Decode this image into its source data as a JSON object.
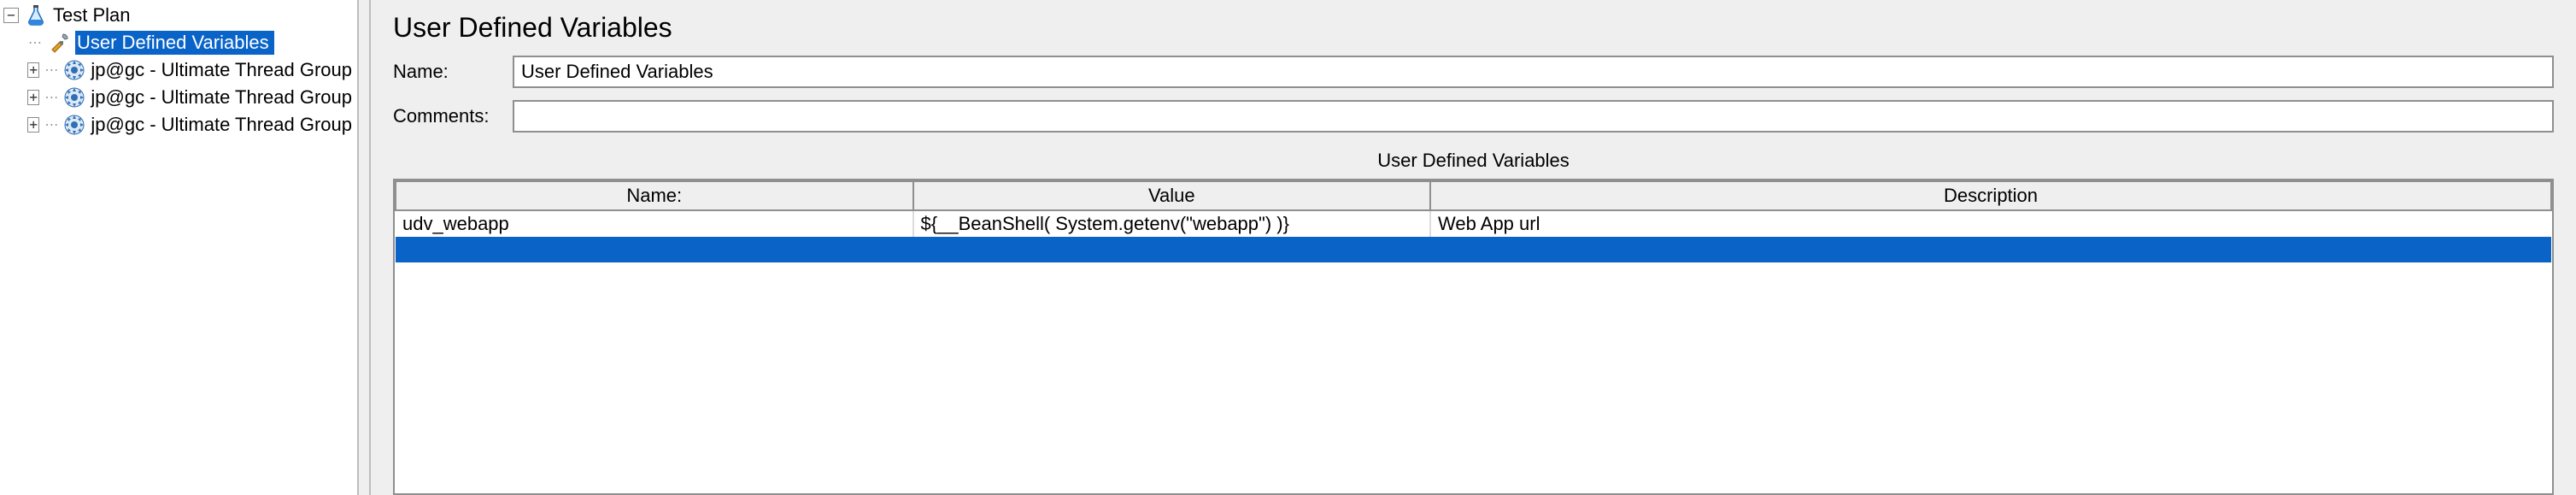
{
  "tree": {
    "root": {
      "label": "Test Plan"
    },
    "children": [
      {
        "label": "User Defined Variables",
        "selected": true,
        "iconType": "tools"
      },
      {
        "label": "jp@gc - Ultimate Thread Group",
        "selected": false,
        "expandable": true,
        "iconType": "gear"
      },
      {
        "label": "jp@gc - Ultimate Thread Group",
        "selected": false,
        "expandable": true,
        "iconType": "gear"
      },
      {
        "label": "jp@gc - Ultimate Thread Group",
        "selected": false,
        "expandable": true,
        "iconType": "gear"
      }
    ]
  },
  "main": {
    "title": "User Defined Variables",
    "form": {
      "name_label": "Name:",
      "name_value": "User Defined Variables",
      "comments_label": "Comments:",
      "comments_value": ""
    },
    "section_label": "User Defined Variables",
    "table": {
      "headers": {
        "name": "Name:",
        "value": "Value",
        "description": "Description"
      },
      "rows": [
        {
          "name": "udv_webapp",
          "value": "${__BeanShell( System.getenv(\"webapp\") )}",
          "description": "Web App url"
        }
      ]
    }
  },
  "glyphs": {
    "minus": "−",
    "plus": "+",
    "dots": "⋯"
  }
}
